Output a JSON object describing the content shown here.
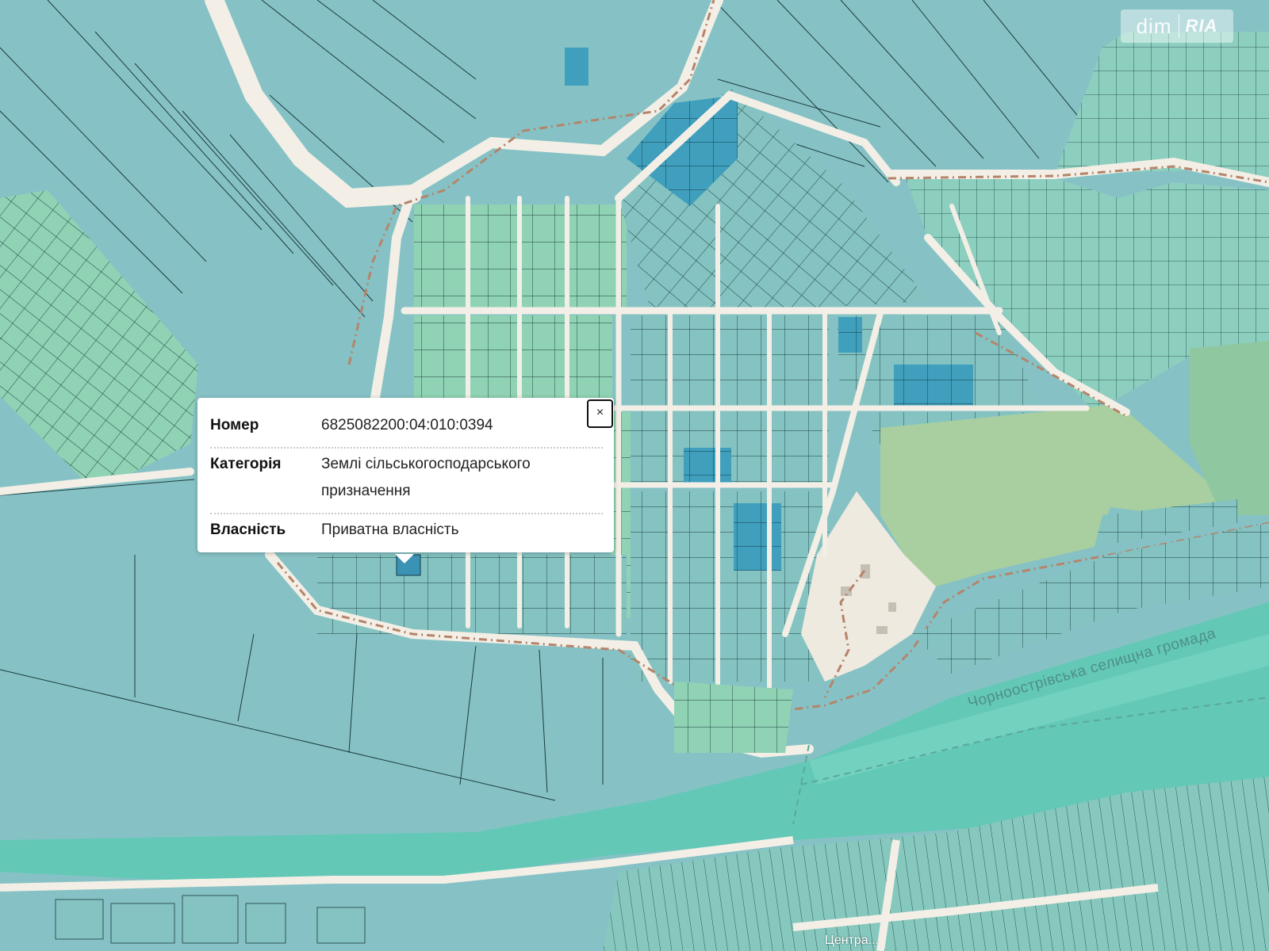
{
  "watermark": {
    "left": "dim",
    "right": "RIA"
  },
  "map": {
    "region_label": "Чорноострівська селищна громада",
    "road_label": "Центра...",
    "colors": {
      "background": "#f1ede4",
      "farmland": "#86c2c5",
      "farmland_dark": "#7bb7bf",
      "parcel_green": "#8fd3b4",
      "parcel_mid": "#84c3c1",
      "parcel_selected": "#3f9fbd",
      "forest": "#a9cfa0",
      "water": "#63c8b6",
      "road": "#f3efe6",
      "boundary": "#b5846a",
      "parcel_line": "#1b3b3e"
    }
  },
  "popup": {
    "close_label": "×",
    "rows": [
      {
        "key": "Номер",
        "value": "6825082200:04:010:0394"
      },
      {
        "key": "Категорія",
        "value": "Землі сільськогосподарського призначення"
      },
      {
        "key": "Власність",
        "value": "Приватна власність"
      }
    ]
  }
}
